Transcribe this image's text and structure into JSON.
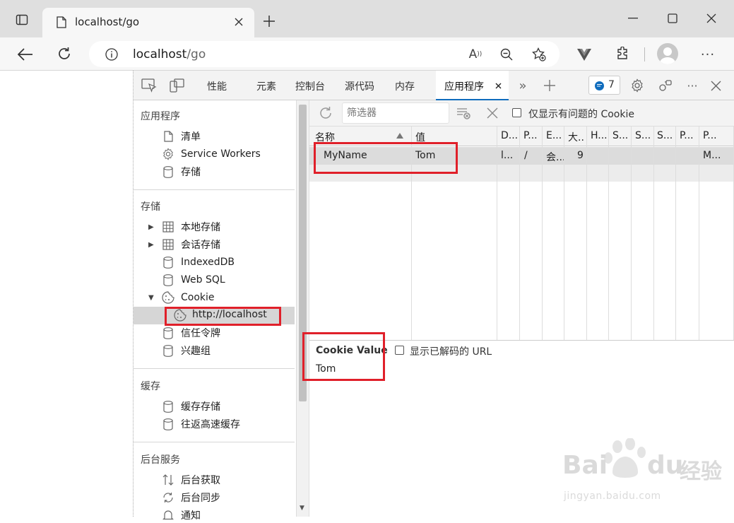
{
  "browser": {
    "tab_title": "localhost/go",
    "address": "localhost/go",
    "address_host": "localhost",
    "address_path": "/go"
  },
  "devtools": {
    "tabs": [
      "性能",
      "元素",
      "控制台",
      "源代码",
      "内存",
      "应用程序"
    ],
    "active_tab": "应用程序",
    "issues_count": "7"
  },
  "sidebar": {
    "sections": [
      {
        "title": "应用程序",
        "items": [
          "清单",
          "Service Workers",
          "存储"
        ]
      },
      {
        "title": "存储",
        "items": [
          "本地存储",
          "会话存储",
          "IndexedDB",
          "Web SQL",
          "Cookie",
          "http://localhost",
          "信任令牌",
          "兴趣组"
        ]
      },
      {
        "title": "缓存",
        "items": [
          "缓存存储",
          "往返高速缓存"
        ]
      },
      {
        "title": "后台服务",
        "items": [
          "后台获取",
          "后台同步",
          "通知"
        ]
      }
    ]
  },
  "cookies": {
    "filter_placeholder": "筛选器",
    "only_issues_label": "仅显示有问题的 Cookie",
    "columns": [
      "名称",
      "值",
      "D...",
      "P...",
      "E...",
      "大..",
      "H...",
      "S...",
      "S...",
      "S...",
      "P...",
      "P..."
    ],
    "rows": [
      {
        "name": "MyName",
        "value": "Tom",
        "domain": "l...",
        "path": "/",
        "expires": "会...",
        "size": "9",
        "last": "M..."
      }
    ],
    "value_panel_title": "Cookie Value",
    "show_decoded_label": "显示已解码的 URL",
    "value_panel_value": "Tom"
  },
  "watermark": {
    "line1": "Bai",
    "line2": "du",
    "line3": "经验",
    "url": "jingyan.baidu.com"
  },
  "colors": {
    "highlight": "#e0202a",
    "selected_row": "#dcdcdc",
    "accent": "#0f6cbd"
  }
}
